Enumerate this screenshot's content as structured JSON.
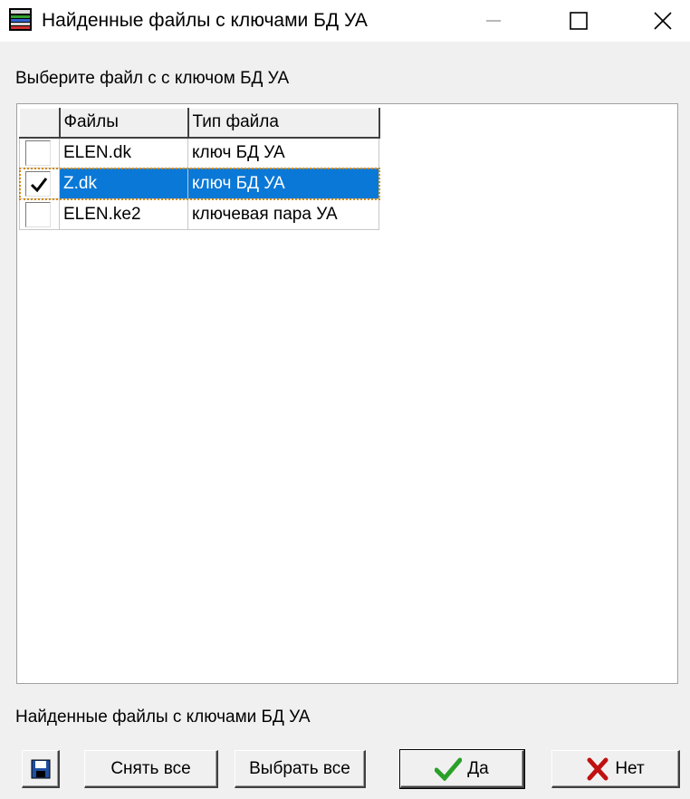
{
  "window": {
    "title": "Найденные файлы с ключами БД УА"
  },
  "prompt": "Выберите файл с с ключом БД УА",
  "table": {
    "columns": [
      "",
      "Файлы",
      "Тип файла"
    ],
    "rows": [
      {
        "checked": false,
        "file": "ELEN.dk",
        "type": "ключ БД УА",
        "selected": false
      },
      {
        "checked": true,
        "file": "Z.dk",
        "type": "ключ БД УА",
        "selected": true
      },
      {
        "checked": false,
        "file": "ELEN.ke2",
        "type": "ключевая пара УА",
        "selected": false
      }
    ]
  },
  "status": "Найденные файлы с ключами БД УА",
  "buttons": {
    "save_icon": "floppy-disk-icon",
    "uncheck_all": "Снять все",
    "select_all": "Выбрать все",
    "yes": "Да",
    "no": "Нет"
  },
  "colors": {
    "selection": "#0a78d7",
    "check_green": "#2aa02a",
    "cross_red": "#c01010"
  }
}
